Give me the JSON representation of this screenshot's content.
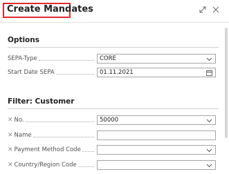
{
  "dialog": {
    "title": "Create Mandates",
    "title_highlight_color": "#e0292f",
    "header_icons": [
      "expand-icon",
      "close-icon"
    ]
  },
  "options": {
    "heading": "Options",
    "sepa_type": {
      "label": "SEPA-Type",
      "value": "CORE",
      "icon": "chevron-down-icon"
    },
    "start_date": {
      "label": "Start Date SEPA",
      "value": "01.11.2021",
      "icon": "calendar-icon"
    }
  },
  "filter": {
    "heading": "Filter: Customer",
    "fields": [
      {
        "label": "No.",
        "value": "50000",
        "icon": "chevron-down-icon"
      },
      {
        "label": "Name",
        "value": "",
        "icon": ""
      },
      {
        "label": "Payment Method Code",
        "value": "",
        "icon": "chevron-down-icon"
      },
      {
        "label": "Country/Region Code",
        "value": "",
        "icon": "chevron-down-icon"
      }
    ]
  }
}
